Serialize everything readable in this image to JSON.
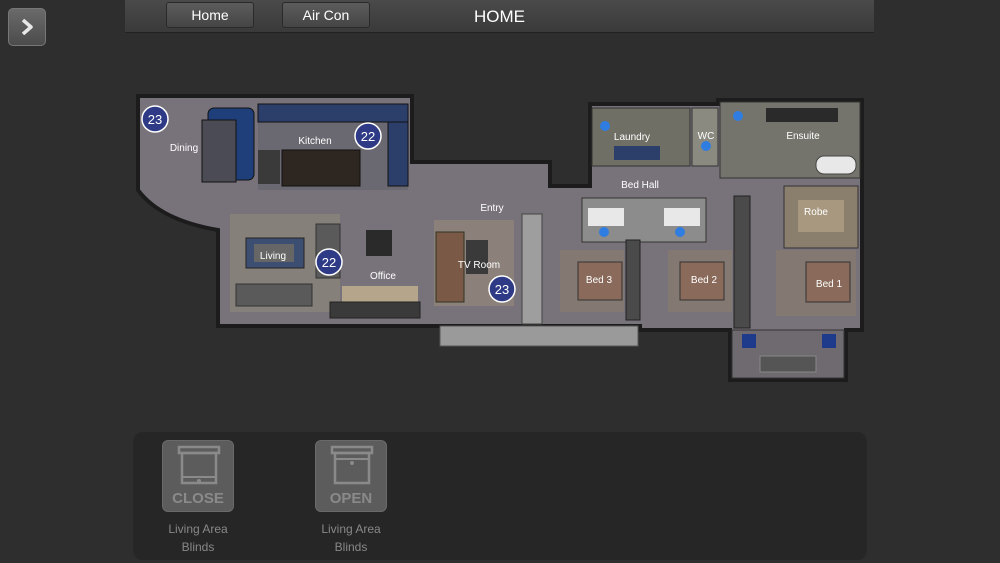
{
  "nav": {
    "home_label": "Home",
    "aircon_label": "Air Con",
    "title": "HOME"
  },
  "rooms": {
    "dining": "Dining",
    "kitchen": "Kitchen",
    "laundry": "Laundry",
    "wc": "WC",
    "ensuite": "Ensuite",
    "bed_hall": "Bed Hall",
    "entry": "Entry",
    "robe": "Robe",
    "living": "Living",
    "office": "Office",
    "tv_room": "TV Room",
    "bed3": "Bed 3",
    "bed2": "Bed 2",
    "bed1": "Bed 1"
  },
  "temperatures": {
    "dining": "23",
    "kitchen": "22",
    "living": "22",
    "tv_room": "23"
  },
  "blinds": [
    {
      "caption": "CLOSE",
      "label_line1": "Living Area",
      "label_line2": "Blinds"
    },
    {
      "caption": "OPEN",
      "label_line1": "Living Area",
      "label_line2": "Blinds"
    }
  ],
  "colors": {
    "badge": "#2e3a86",
    "light_on": "#2f7de0",
    "floor": "#78727a"
  }
}
